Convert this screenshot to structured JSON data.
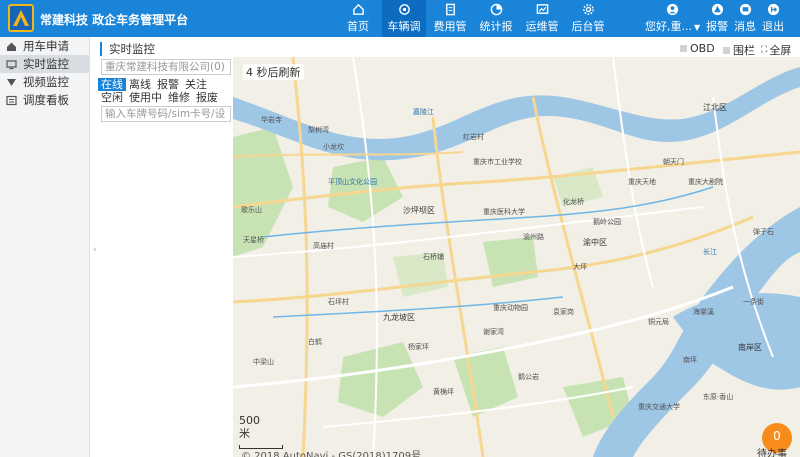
{
  "app": {
    "title": "常建科技 政企车务管理平台"
  },
  "nav": {
    "items": [
      {
        "label": "首页",
        "icon": "home-icon"
      },
      {
        "label": "车辆调",
        "icon": "dispatch-icon",
        "active": true
      },
      {
        "label": "费用管",
        "icon": "fee-icon"
      },
      {
        "label": "统计报",
        "icon": "stats-icon"
      },
      {
        "label": "运维管",
        "icon": "ops-icon"
      },
      {
        "label": "后台管",
        "icon": "settings-icon"
      }
    ]
  },
  "user": {
    "greeting": "您好,重...",
    "alarm": "报警",
    "messages": "消息",
    "logout": "退出"
  },
  "sidebar": {
    "items": [
      {
        "label": "用车申请",
        "icon": "car-request-icon"
      },
      {
        "label": "实时监控",
        "icon": "monitor-icon",
        "active": true
      },
      {
        "label": "视频监控",
        "icon": "video-icon"
      },
      {
        "label": "调度看板",
        "icon": "board-icon"
      }
    ]
  },
  "panel": {
    "title": "实时监控",
    "company": "重庆常建科技有限公司(0)",
    "status_row1": [
      "在线",
      "离线",
      "报警",
      "关注"
    ],
    "status_row2": [
      "空闲",
      "使用中",
      "维修",
      "报废"
    ],
    "plate_placeholder": "输入车牌号码/sim卡号/设"
  },
  "map_header": {
    "obd": "OBD",
    "fence": "围栏",
    "fullscreen": "全屏"
  },
  "map": {
    "refresh": "4 秒后刷新",
    "scale": "500 米",
    "copyright": "© 2018 AutoNavi - GS(2018)1709号",
    "badge_count": "0",
    "badge_label": "待办事",
    "labels": [
      "华岩寺",
      "梨树湾",
      "小龙坎",
      "平顶山文化公园",
      "歌乐山",
      "天星桥",
      "重庆市工业学校",
      "沙坪坝区",
      "石桥铺",
      "高庙村",
      "重庆医科大学",
      "渝州路",
      "大坪",
      "化龙桥",
      "九龙坡区",
      "黄桷坪",
      "鹅公岩",
      "谢家湾",
      "石坪村",
      "重庆动物园",
      "杨家坪",
      "中梁山",
      "白鹤",
      "袁家岗",
      "红岩村",
      "鹅岭公园",
      "重庆天地",
      "嘉陵江",
      "长江",
      "江北区",
      "南坪",
      "渝中区",
      "朝天门",
      "重庆大剧院",
      "一条街",
      "弹子石",
      "南岸区",
      "铜元局",
      "海棠溪",
      "东原·香山",
      "重庆交通大学"
    ]
  },
  "colors": {
    "topbar": "#1a84d8",
    "active": "#0d6cbf",
    "badge": "#f78c1a",
    "river": "#9ec7e6",
    "park": "#c7e3b4"
  }
}
